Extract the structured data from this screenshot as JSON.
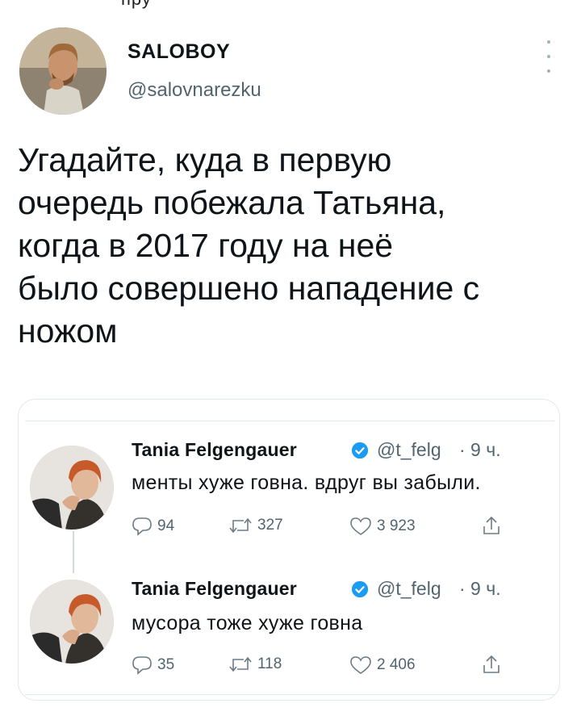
{
  "top_fragment": "пру",
  "author": {
    "name": "SALOBOY",
    "handle": "@salovnarezku"
  },
  "icons": {
    "more": "more-vertical-icon",
    "verified": "verified-badge-icon",
    "reply": "reply-icon",
    "retweet": "retweet-icon",
    "like": "heart-icon",
    "share": "share-icon"
  },
  "colors": {
    "verified_blue": "#1d9bf0",
    "secondary_text": "#536471",
    "border": "#e1e8ed"
  },
  "tweet": {
    "text": "Угадайте, куда в первую\nочередь побежала Татьяна,\nкогда в 2017 году на неё\nбыло совершено нападение с\nножом"
  },
  "quote": {
    "tweets": [
      {
        "name": "Tania Felgengauer",
        "handle": "@t_felg",
        "time": "· 9 ч.",
        "text": "менты хуже говна. вдруг вы забыли.",
        "replies": "94",
        "retweets": "327",
        "likes": "3 923"
      },
      {
        "name": "Tania Felgengauer",
        "handle": "@t_felg",
        "time": "· 9 ч.",
        "text": "мусора тоже хуже говна",
        "replies": "35",
        "retweets": "118",
        "likes": "2 406"
      }
    ]
  }
}
